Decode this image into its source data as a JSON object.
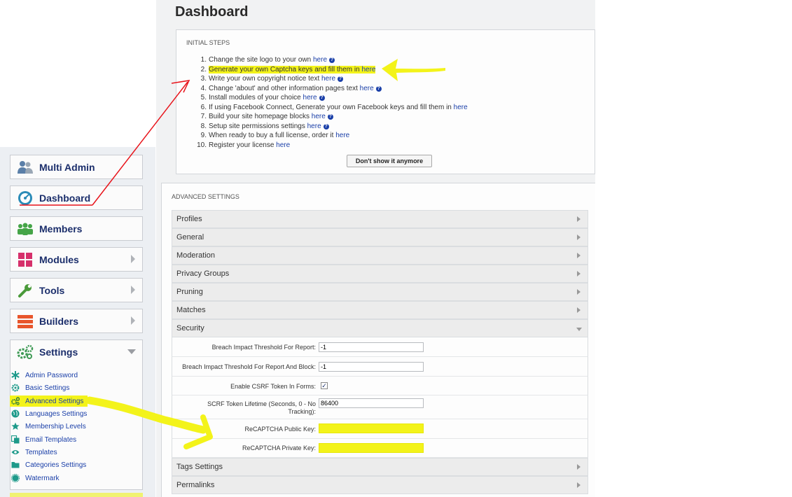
{
  "nav": {
    "items": [
      {
        "label": "Multi Admin",
        "icon": "users-icon"
      },
      {
        "label": "Dashboard",
        "icon": "gauge-icon"
      },
      {
        "label": "Members",
        "icon": "members-icon"
      },
      {
        "label": "Modules",
        "icon": "grid-icon"
      },
      {
        "label": "Tools",
        "icon": "wrench-icon"
      },
      {
        "label": "Builders",
        "icon": "layers-icon"
      },
      {
        "label": "Settings",
        "icon": "gears-icon"
      }
    ],
    "settings_submenu": [
      {
        "label": "Admin Password",
        "icon": "asterisk-icon"
      },
      {
        "label": "Basic Settings",
        "icon": "gear-icon"
      },
      {
        "label": "Advanced Settings",
        "icon": "gears-icon"
      },
      {
        "label": "Languages Settings",
        "icon": "globe-icon"
      },
      {
        "label": "Membership Levels",
        "icon": "star-icon"
      },
      {
        "label": "Email Templates",
        "icon": "copy-icon"
      },
      {
        "label": "Templates",
        "icon": "eye-icon"
      },
      {
        "label": "Categories Settings",
        "icon": "folder-icon"
      },
      {
        "label": "Watermark",
        "icon": "seal-icon"
      }
    ]
  },
  "page": {
    "title": "Dashboard"
  },
  "initial_steps": {
    "title": "INITIAL STEPS",
    "items": [
      {
        "num": "1.",
        "text": "Change the site logo to your own",
        "link": "here",
        "help": true
      },
      {
        "num": "2.",
        "text": "Generate your own Captcha keys and fill them in",
        "link": "here",
        "help": false
      },
      {
        "num": "3.",
        "text": "Write your own copyright notice text",
        "link": "here",
        "help": true
      },
      {
        "num": "4.",
        "text": "Change 'about' and other information pages text",
        "link": "here",
        "help": true
      },
      {
        "num": "5.",
        "text": "Install modules of your choice",
        "link": "here",
        "help": true
      },
      {
        "num": "6.",
        "text": "If using Facebook Connect, Generate your own Facebook keys and fill them in",
        "link": "here",
        "help": false
      },
      {
        "num": "7.",
        "text": "Build your site homepage blocks",
        "link": "here",
        "help": true
      },
      {
        "num": "8.",
        "text": "Setup site permissions settings",
        "link": "here",
        "help": true
      },
      {
        "num": "9.",
        "text": "When ready to buy a full license, order it",
        "link": "here",
        "help": false
      },
      {
        "num": "10.",
        "text": "Register your license",
        "link": "here",
        "help": false
      }
    ],
    "dismiss_label": "Don't show it anymore",
    "help_glyph": "?"
  },
  "advanced": {
    "title": "ADVANCED SETTINGS",
    "sections": [
      "Profiles",
      "General",
      "Moderation",
      "Privacy Groups",
      "Pruning",
      "Matches",
      "Security"
    ],
    "security_fields": [
      {
        "label": "Breach Impact Threshold For Report:",
        "value": "-1"
      },
      {
        "label": "Breach Impact Threshold For Report And Block:",
        "value": "-1"
      },
      {
        "label": "Enable CSRF Token In Forms:",
        "checked": true,
        "check_glyph": "✓"
      },
      {
        "label_line1": "SCRF Token Lifetime (Seconds, 0 - No",
        "label_line2": "Tracking):",
        "value": "86400"
      },
      {
        "label": "ReCAPTCHA Public Key:",
        "value": ""
      },
      {
        "label": "ReCAPTCHA Private Key:",
        "value": ""
      }
    ],
    "sections_after": [
      "Tags Settings",
      "Permalinks"
    ]
  },
  "annotation_colors": {
    "highlight": "#f3f31a",
    "arrow": "#e8131a"
  }
}
